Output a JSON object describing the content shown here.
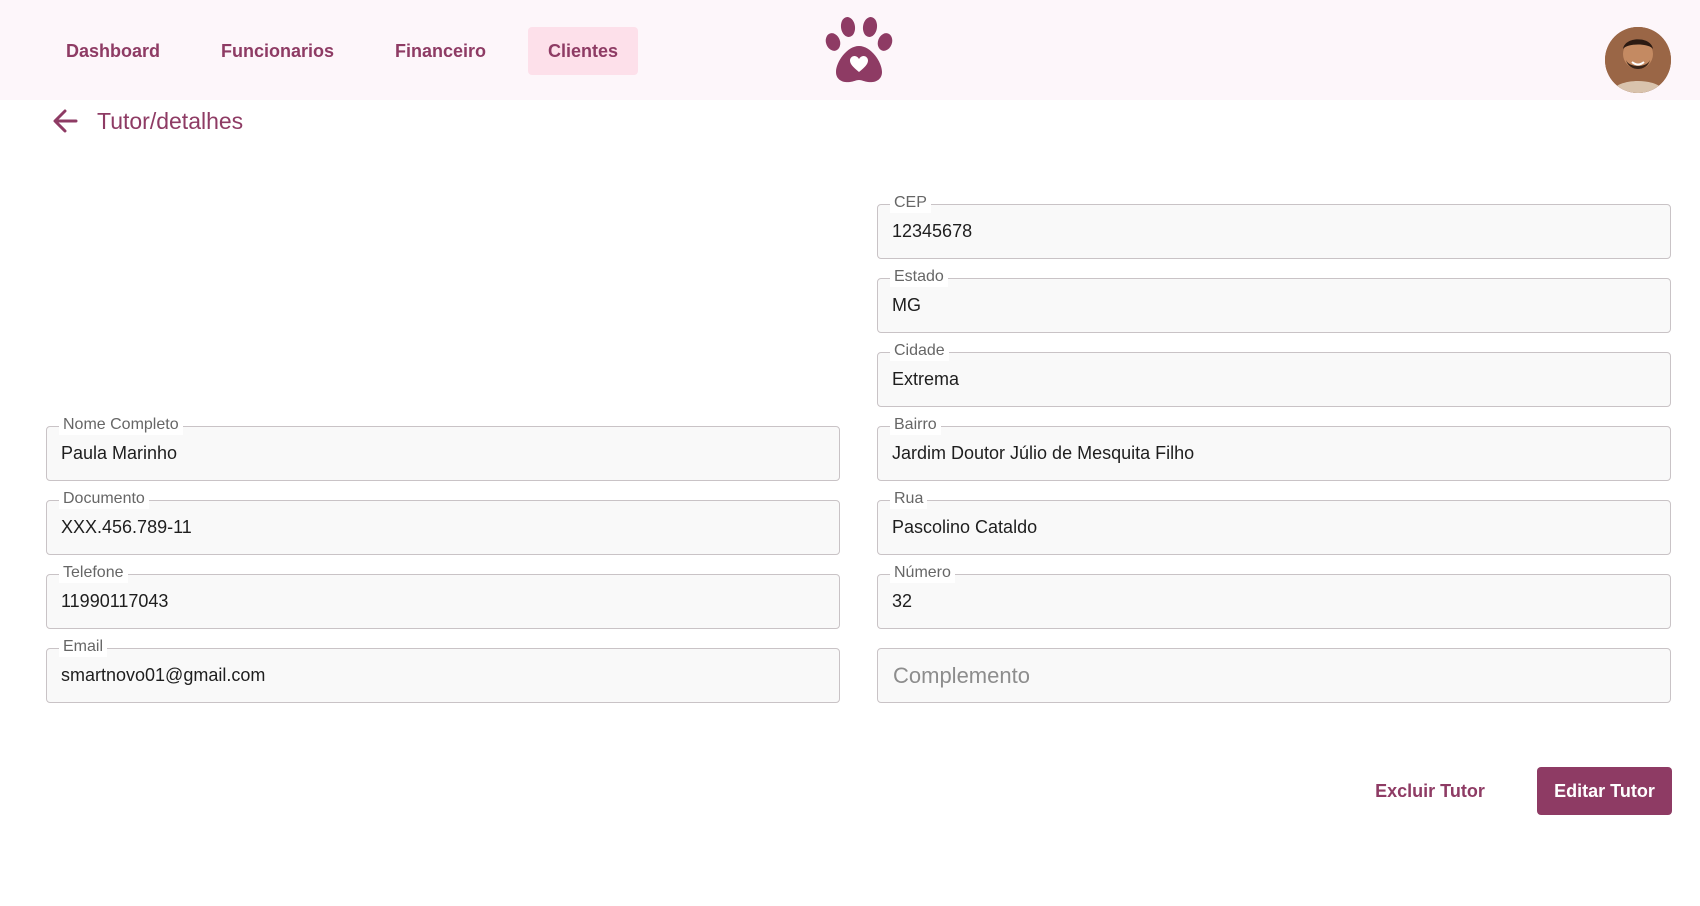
{
  "nav": {
    "items": [
      {
        "label": "Dashboard",
        "active": false
      },
      {
        "label": "Funcionarios",
        "active": false
      },
      {
        "label": "Financeiro",
        "active": false
      },
      {
        "label": "Clientes",
        "active": true
      }
    ]
  },
  "header": {
    "logo_icon": "paw-heart-icon",
    "avatar_icon": "user-avatar"
  },
  "page": {
    "back_icon": "arrow-left-icon",
    "title": "Tutor/detalhes"
  },
  "form": {
    "left": [
      {
        "label": "Nome Completo",
        "value": "Paula Marinho"
      },
      {
        "label": "Documento",
        "value": "XXX.456.789-11"
      },
      {
        "label": "Telefone",
        "value": "11990117043"
      },
      {
        "label": "Email",
        "value": "smartnovo01@gmail.com"
      }
    ],
    "right": [
      {
        "label": "CEP",
        "value": "12345678"
      },
      {
        "label": "Estado",
        "value": "MG"
      },
      {
        "label": "Cidade",
        "value": "Extrema"
      },
      {
        "label": "Bairro",
        "value": "Jardim Doutor Júlio de Mesquita Filho"
      },
      {
        "label": "Rua",
        "value": "Pascolino Cataldo"
      },
      {
        "label": "Número",
        "value": "32"
      }
    ],
    "complemento": {
      "placeholder": "Complemento",
      "value": ""
    }
  },
  "actions": {
    "delete_label": "Excluir Tutor",
    "edit_label": "Editar Tutor"
  },
  "colors": {
    "brand": "#8e3b64",
    "nav_active_bg": "#fde0ea",
    "topbar_bg": "#fdf6fa",
    "field_bg": "#f9f9f9",
    "field_border": "#c9c3c6"
  }
}
